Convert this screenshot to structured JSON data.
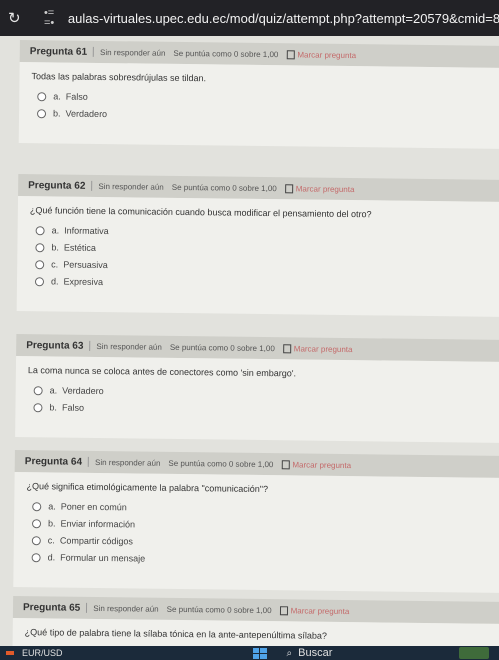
{
  "browser": {
    "url": "aulas-virtuales.upec.edu.ec/mod/quiz/attempt.php?attempt=20579&cmid=8"
  },
  "questions": [
    {
      "number": "Pregunta 61",
      "status": "Sin responder aún",
      "grade": "Se puntúa como 0 sobre 1,00",
      "flag": "Marcar pregunta",
      "text": "Todas las palabras sobresdrújulas se tildan.",
      "options": [
        {
          "letter": "a.",
          "label": "Falso"
        },
        {
          "letter": "b.",
          "label": "Verdadero"
        }
      ]
    },
    {
      "number": "Pregunta 62",
      "status": "Sin responder aún",
      "grade": "Se puntúa como 0 sobre 1,00",
      "flag": "Marcar pregunta",
      "text": "¿Qué función tiene la comunicación cuando busca modificar el pensamiento del otro?",
      "options": [
        {
          "letter": "a.",
          "label": "Informativa"
        },
        {
          "letter": "b.",
          "label": "Estética"
        },
        {
          "letter": "c.",
          "label": "Persuasiva"
        },
        {
          "letter": "d.",
          "label": "Expresiva"
        }
      ]
    },
    {
      "number": "Pregunta 63",
      "status": "Sin responder aún",
      "grade": "Se puntúa como 0 sobre 1,00",
      "flag": "Marcar pregunta",
      "text": "La coma nunca se coloca antes de conectores como 'sin embargo'.",
      "options": [
        {
          "letter": "a.",
          "label": "Verdadero"
        },
        {
          "letter": "b.",
          "label": "Falso"
        }
      ]
    },
    {
      "number": "Pregunta 64",
      "status": "Sin responder aún",
      "grade": "Se puntúa como 0 sobre 1,00",
      "flag": "Marcar pregunta",
      "text": "¿Qué significa etimológicamente la palabra \"comunicación\"?",
      "options": [
        {
          "letter": "a.",
          "label": "Poner en común"
        },
        {
          "letter": "b.",
          "label": "Enviar información"
        },
        {
          "letter": "c.",
          "label": "Compartir códigos"
        },
        {
          "letter": "d.",
          "label": "Formular un mensaje"
        }
      ]
    },
    {
      "number": "Pregunta 65",
      "status": "Sin responder aún",
      "grade": "Se puntúa como 0 sobre 1,00",
      "flag": "Marcar pregunta",
      "text": "¿Qué tipo de palabra tiene la sílaba tónica en la ante-antepenúltima sílaba?",
      "options": []
    }
  ],
  "taskbar": {
    "rate": "EUR/USD",
    "search_label": "Buscar"
  }
}
